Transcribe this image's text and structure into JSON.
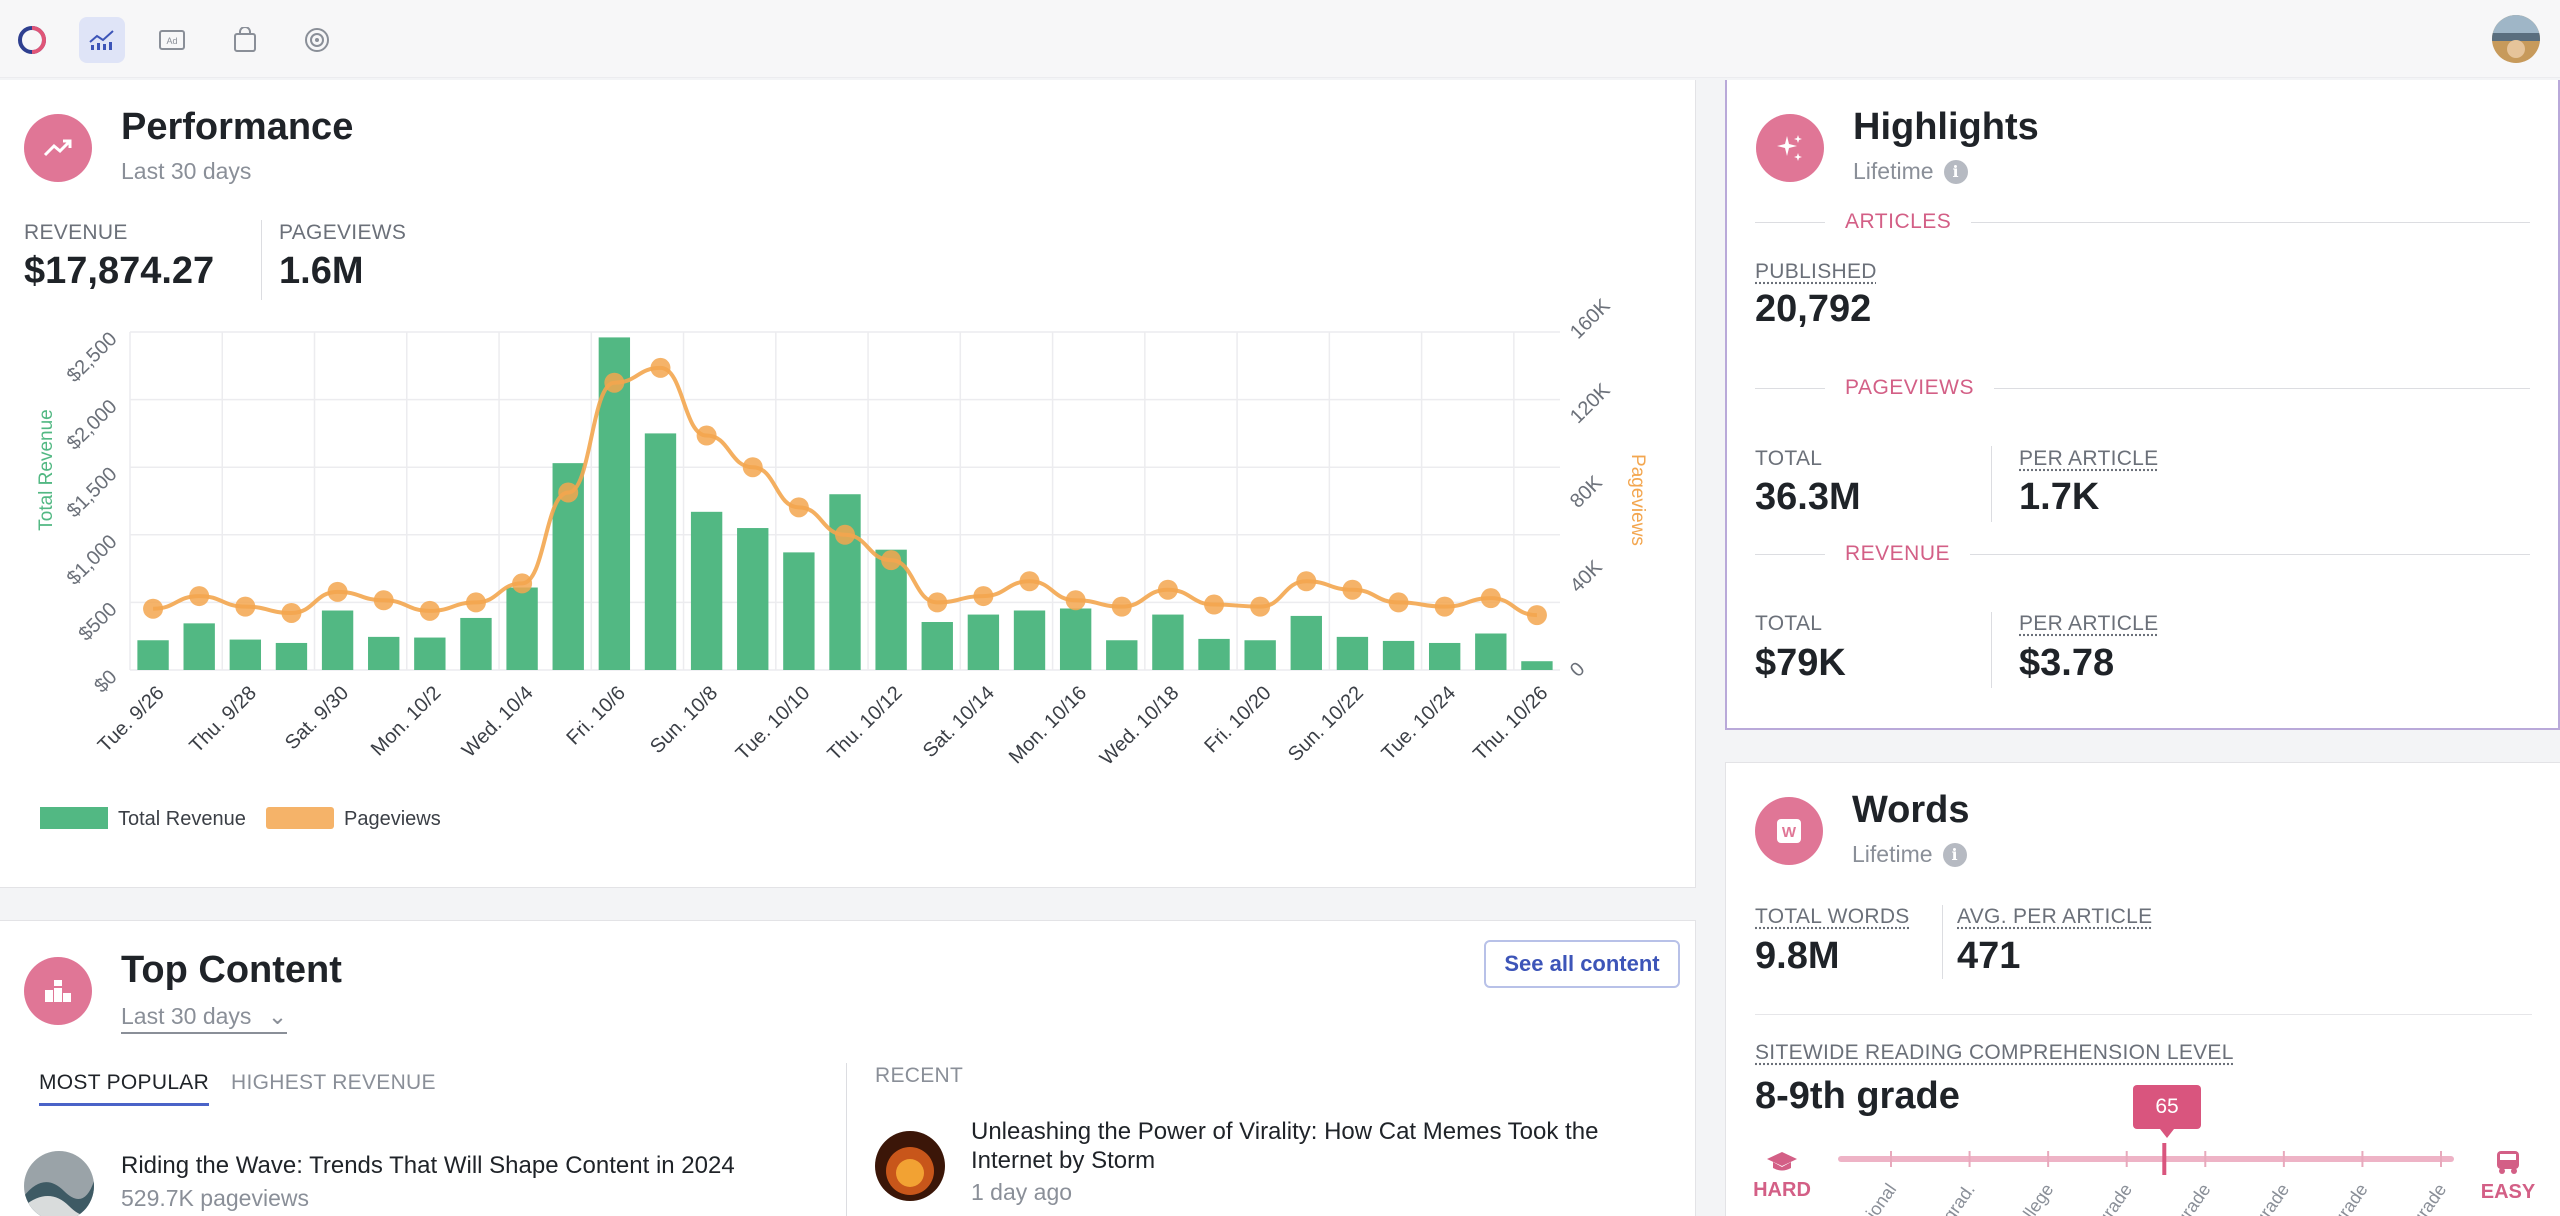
{
  "topbar": {
    "nav_icons": [
      "logo-icon",
      "analytics-icon",
      "ad-icon",
      "shop-icon",
      "target-icon"
    ]
  },
  "performance": {
    "title": "Performance",
    "subtitle": "Last 30 days",
    "revenue_label": "REVENUE",
    "revenue_value": "$17,874.27",
    "pageviews_label": "PAGEVIEWS",
    "pageviews_value": "1.6M"
  },
  "chart_data": {
    "type": "bar",
    "categories": [
      "9/26",
      "9/27",
      "9/28",
      "9/29",
      "9/30",
      "10/1",
      "10/2",
      "10/3",
      "10/4",
      "10/5",
      "10/6",
      "10/7",
      "10/8",
      "10/9",
      "10/10",
      "10/11",
      "10/12",
      "10/13",
      "10/14",
      "10/15",
      "10/16",
      "10/17",
      "10/18",
      "10/19",
      "10/20",
      "10/21",
      "10/22",
      "10/23",
      "10/24",
      "10/25",
      "10/26"
    ],
    "tick_labels": [
      "Tue. 9/26",
      "Thu. 9/28",
      "Sat. 9/30",
      "Mon. 10/2",
      "Wed. 10/4",
      "Fri. 10/6",
      "Sun. 10/8",
      "Tue. 10/10",
      "Thu. 10/12",
      "Sat. 10/14",
      "Mon. 10/16",
      "Wed. 10/18",
      "Fri. 10/20",
      "Sun. 10/22",
      "Tue. 10/24",
      "Thu. 10/26"
    ],
    "series": [
      {
        "name": "Total Revenue",
        "type": "bar",
        "axis": "left",
        "color": "#52b883",
        "values": [
          220,
          345,
          225,
          200,
          440,
          245,
          240,
          385,
          610,
          1530,
          2460,
          1750,
          1170,
          1050,
          870,
          1300,
          890,
          355,
          410,
          440,
          455,
          220,
          410,
          230,
          220,
          400,
          245,
          215,
          200,
          270,
          65
        ]
      },
      {
        "name": "Pageviews",
        "type": "line",
        "axis": "right",
        "color": "#f3a64f",
        "values": [
          29000,
          35000,
          30000,
          27000,
          37000,
          33000,
          28000,
          32000,
          41000,
          84000,
          136000,
          143000,
          111000,
          96000,
          77000,
          64000,
          52000,
          32000,
          35000,
          42000,
          33000,
          30000,
          38000,
          31000,
          30000,
          42000,
          38000,
          32000,
          30000,
          34000,
          26000
        ]
      }
    ],
    "ylabel_left": "Total Revenue",
    "ylabel_right": "Pageviews",
    "ylim_left": [
      0,
      2500
    ],
    "ylim_right": [
      0,
      160000
    ],
    "yticks_left": [
      "$0",
      "$500",
      "$1,000",
      "$1,500",
      "$2,000",
      "$2,500"
    ],
    "yticks_right": [
      "0",
      "40K",
      "80K",
      "120K",
      "160K"
    ],
    "grid": true,
    "legend_position": "bottom-left"
  },
  "highlights": {
    "title": "Highlights",
    "subtitle": "Lifetime",
    "articles_section": "ARTICLES",
    "published_label": "PUBLISHED",
    "published_value": "20,792",
    "pageviews_section": "PAGEVIEWS",
    "pv_total_label": "TOTAL",
    "pv_total_value": "36.3M",
    "pv_per_label": "PER ARTICLE",
    "pv_per_value": "1.7K",
    "revenue_section": "REVENUE",
    "rev_total_label": "TOTAL",
    "rev_total_value": "$79K",
    "rev_per_label": "PER ARTICLE",
    "rev_per_value": "$3.78"
  },
  "words": {
    "title": "Words",
    "subtitle": "Lifetime",
    "total_words_label": "TOTAL WORDS",
    "total_words_value": "9.8M",
    "avg_label": "AVG. PER ARTICLE",
    "avg_value": "471",
    "reading_label": "SITEWIDE READING COMPREHENSION LEVEL",
    "reading_value": "8-9th grade",
    "score": "65",
    "score_fraction": 0.53,
    "hard_label": "HARD",
    "easy_label": "EASY",
    "scale_labels": [
      "ssional",
      "grad.",
      "College",
      "grade",
      "grade",
      "grade",
      "grade",
      "grade"
    ]
  },
  "top_content": {
    "title": "Top Content",
    "range": "Last 30 days",
    "see_all": "See all content",
    "tab_popular": "MOST POPULAR",
    "tab_revenue": "HIGHEST REVENUE",
    "recent_label": "RECENT",
    "popular_item_title": "Riding the Wave: Trends That Will Shape Content in 2024",
    "popular_item_sub": "529.7K pageviews",
    "recent_item_title": "Unleashing the Power of Virality: How Cat Memes Took the Internet by Storm",
    "recent_item_sub": "1 day ago"
  }
}
